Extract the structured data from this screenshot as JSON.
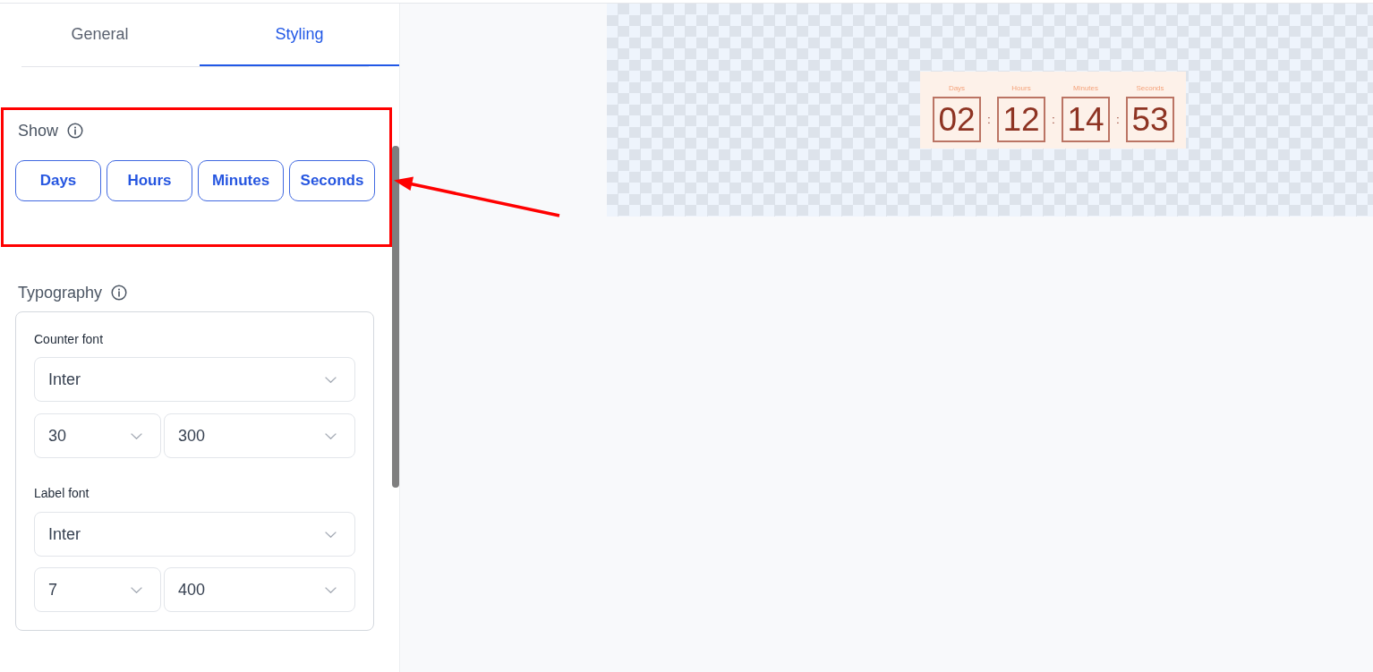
{
  "tabs": [
    {
      "label": "General",
      "selected": false
    },
    {
      "label": "Styling",
      "selected": true
    }
  ],
  "show": {
    "title": "Show",
    "options": [
      {
        "label": "Days",
        "selected": true
      },
      {
        "label": "Hours",
        "selected": true
      },
      {
        "label": "Minutes",
        "selected": true
      },
      {
        "label": "Seconds",
        "selected": true
      }
    ]
  },
  "typography": {
    "title": "Typography",
    "groups": [
      {
        "label": "Counter font",
        "family": "Inter",
        "size": "30",
        "weight": "300"
      },
      {
        "label": "Label font",
        "family": "Inter",
        "size": "7",
        "weight": "400"
      }
    ]
  },
  "preview": {
    "items": [
      {
        "kind": "unit",
        "label": "Days",
        "value": "02"
      },
      {
        "kind": "separator",
        "text": ":"
      },
      {
        "kind": "unit",
        "label": "Hours",
        "value": "12"
      },
      {
        "kind": "separator",
        "text": ":"
      },
      {
        "kind": "unit",
        "label": "Minutes",
        "value": "14"
      },
      {
        "kind": "separator",
        "text": ":"
      },
      {
        "kind": "unit",
        "label": "Seconds",
        "value": "53"
      }
    ]
  }
}
